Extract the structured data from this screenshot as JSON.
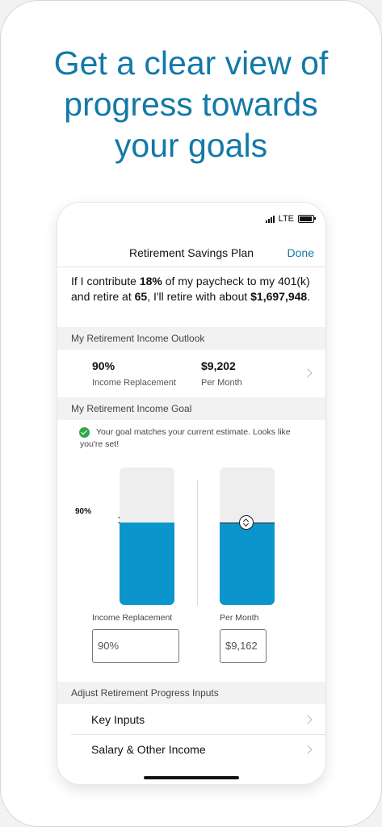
{
  "headline": {
    "lines": [
      "Get a clear view of",
      "progress towards",
      "your goals"
    ]
  },
  "status_bar": {
    "network": "LTE"
  },
  "nav": {
    "title": "Retirement Savings Plan",
    "done_label": "Done"
  },
  "summary": {
    "t1": "If I contribute ",
    "contribution": "18%",
    "t2": " of my paycheck to my 401(k) and retire at ",
    "retire_age": "65",
    "t3": ", I'll retire with about ",
    "amount": "$1,697,948",
    "t4": "."
  },
  "outlook": {
    "header": "My Retirement Income Outlook",
    "replacement_value": "90%",
    "replacement_label": "Income Replacement",
    "monthly_value": "$9,202",
    "monthly_label": "Per Month"
  },
  "goal": {
    "header": "My Retirement Income Goal",
    "message": "Your goal matches your current estimate. Looks like you're set!",
    "marker_label": "90%",
    "replacement_fill": 0.6,
    "monthly_fill": 0.6,
    "replacement_label": "Income Replacement",
    "monthly_label": "Per Month",
    "replacement_input": "90%",
    "monthly_input": "$9,162",
    "fill_color": "#0a96cc"
  },
  "adjust": {
    "header": "Adjust Retirement Progress Inputs",
    "items": [
      {
        "label": "Key Inputs"
      },
      {
        "label": "Salary & Other Income"
      }
    ]
  },
  "colors": {
    "accent": "#1279a8",
    "success": "#2ea84a"
  }
}
